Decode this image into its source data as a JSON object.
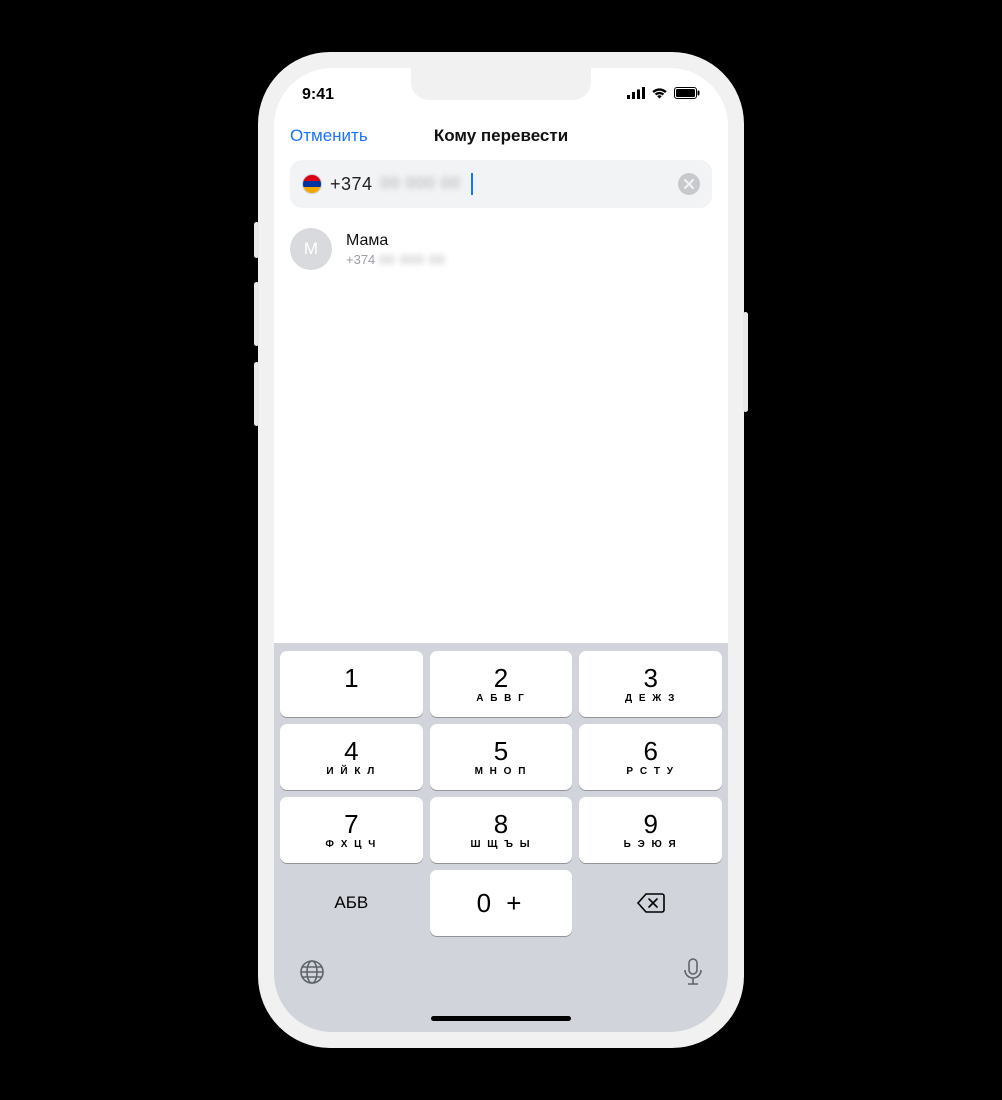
{
  "status": {
    "time": "9:41"
  },
  "nav": {
    "cancel": "Отменить",
    "title": "Кому перевести"
  },
  "input": {
    "dial_prefix": "+374",
    "masked_rest": "00 000 00"
  },
  "contact": {
    "initial": "М",
    "name": "Мама",
    "phone_prefix": "+374",
    "phone_masked": "00 000 00"
  },
  "keys": {
    "k1": "1",
    "k2": "2",
    "l2": "А Б В Г",
    "k3": "3",
    "l3": "Д Е Ж З",
    "k4": "4",
    "l4": "И Й К Л",
    "k5": "5",
    "l5": "М Н О П",
    "k6": "6",
    "l6": "Р С Т У",
    "k7": "7",
    "l7": "Ф Х Ц Ч",
    "k8": "8",
    "l8": "Ш Щ Ъ Ы",
    "k9": "9",
    "l9": "Ь Э Ю Я",
    "k0": "0 +",
    "abc": "АБВ"
  }
}
